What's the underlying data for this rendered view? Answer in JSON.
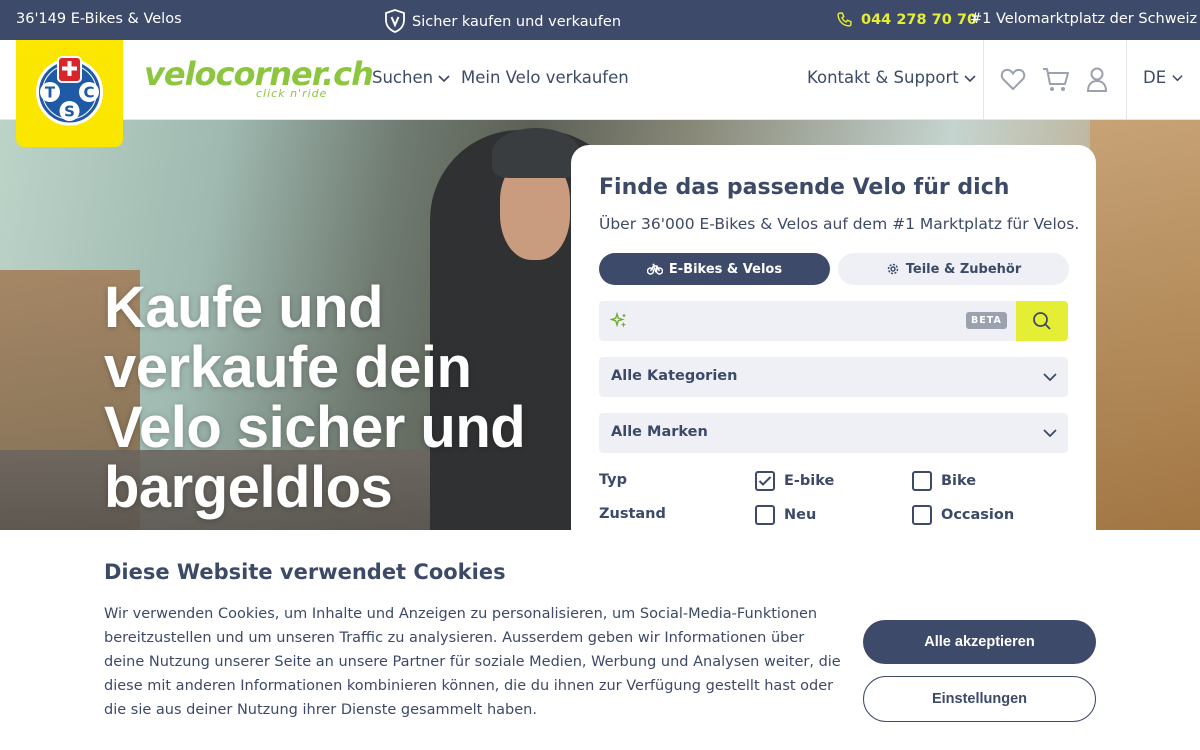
{
  "topbar": {
    "count": "36'149 E-Bikes & Velos",
    "secure": "Sicher kaufen und verkaufen",
    "phone": "044 278 70 70",
    "tagline": "#1 Velomarktplatz der Schweiz"
  },
  "header": {
    "tcs_letters": [
      "T",
      "C",
      "S"
    ],
    "brand_name": "velocorner.ch",
    "brand_sub": "click n'ride",
    "nav": {
      "suchen": "Suchen",
      "verkaufen": "Mein Velo verkaufen",
      "kontakt": "Kontakt & Support"
    },
    "language": "DE"
  },
  "hero": {
    "title": "Kaufe und verkaufe dein Velo sicher und bargeldlos"
  },
  "search_card": {
    "title": "Finde das passende Velo für dich",
    "subtitle": "Über 36'000 E-Bikes & Velos auf dem #1 Marktplatz für Velos.",
    "tabs": {
      "bikes": "E-Bikes & Velos",
      "parts": "Teile & Zubehör"
    },
    "search_placeholder": "",
    "beta": "BETA",
    "category_select": "Alle Kategorien",
    "brand_select": "Alle Marken",
    "filters": {
      "typ_label": "Typ",
      "zustand_label": "Zustand",
      "ebike": "E-bike",
      "bike": "Bike",
      "neu": "Neu",
      "occasion": "Occasion"
    }
  },
  "cookie": {
    "title": "Diese Website verwendet Cookies",
    "text": "Wir verwenden Cookies, um Inhalte und Anzeigen zu personalisieren, um Social-Media-Funktionen bereitzustellen und um unseren Traffic zu analysieren. Ausserdem geben wir Informationen über deine Nutzung unserer Seite an unsere Partner für soziale Medien, Werbung und Analysen weiter, die diese mit anderen Informationen kombinieren können, die du ihnen zur Verfügung gestellt hast oder die sie aus deiner Nutzung ihrer Dienste gesammelt haben.",
    "accept": "Alle akzeptieren",
    "settings": "Einstellungen"
  },
  "colors": {
    "navy": "#3e4a6a",
    "lime": "#e3ee35",
    "brand_green": "#8cc63f",
    "tcs_yellow": "#fbe600"
  }
}
